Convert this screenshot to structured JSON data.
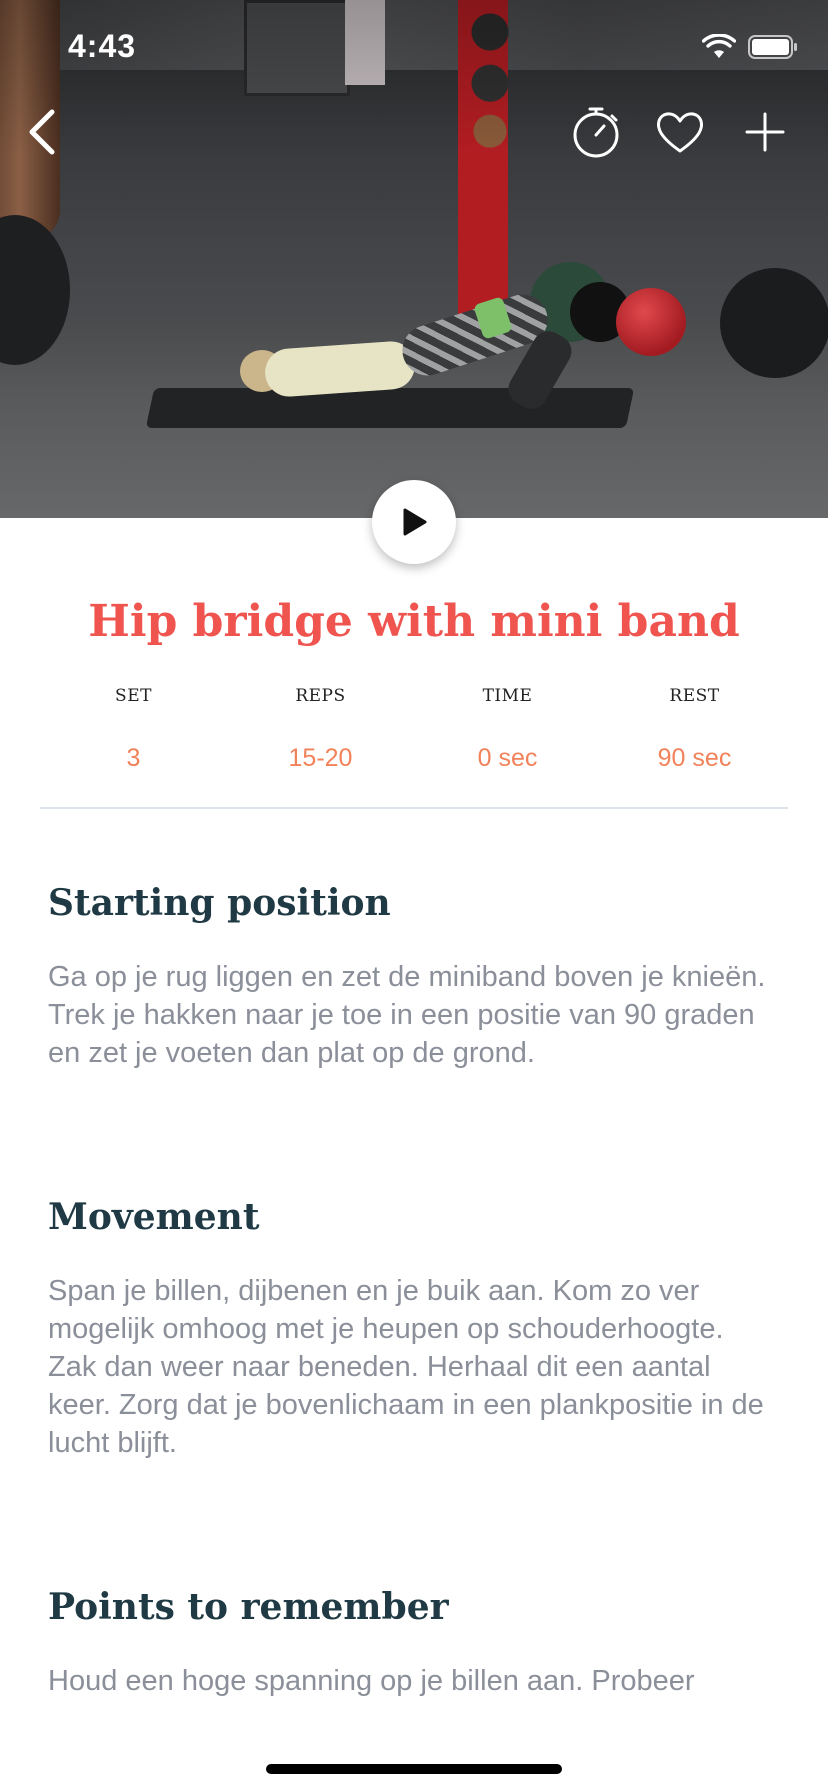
{
  "status_bar": {
    "time": "4:43"
  },
  "exercise": {
    "title": "Hip bridge with mini band",
    "stats": [
      {
        "label": "SET",
        "value": "3"
      },
      {
        "label": "REPS",
        "value": "15-20"
      },
      {
        "label": "TIME",
        "value": "0 sec"
      },
      {
        "label": "REST",
        "value": "90 sec"
      }
    ]
  },
  "sections": [
    {
      "heading": "Starting position",
      "text": "Ga op je rug liggen en zet de miniband boven je knieën. Trek je hakken naar je toe in een positie van 90 graden en zet je voeten dan plat op de grond."
    },
    {
      "heading": "Movement",
      "text": "Span je billen, dijbenen en je buik aan. Kom zo ver mogelijk omhoog met je heupen op schouderhoogte. Zak dan weer naar beneden. Herhaal dit een aantal keer. Zorg dat je bovenlichaam in een plankpositie in de lucht blijft."
    },
    {
      "heading": "Points to remember",
      "text": "Houd een hoge spanning op je billen aan. Probeer"
    }
  ],
  "icons": {
    "back": "chevron-left-icon",
    "timer": "stopwatch-icon",
    "favorite": "heart-icon",
    "add": "plus-icon",
    "play": "play-icon",
    "wifi": "wifi-icon",
    "battery": "battery-icon"
  },
  "colors": {
    "title": "#f0544f",
    "stat_value": "#f2825a",
    "heading": "#1f3a44",
    "body_text": "#8b8f99"
  }
}
